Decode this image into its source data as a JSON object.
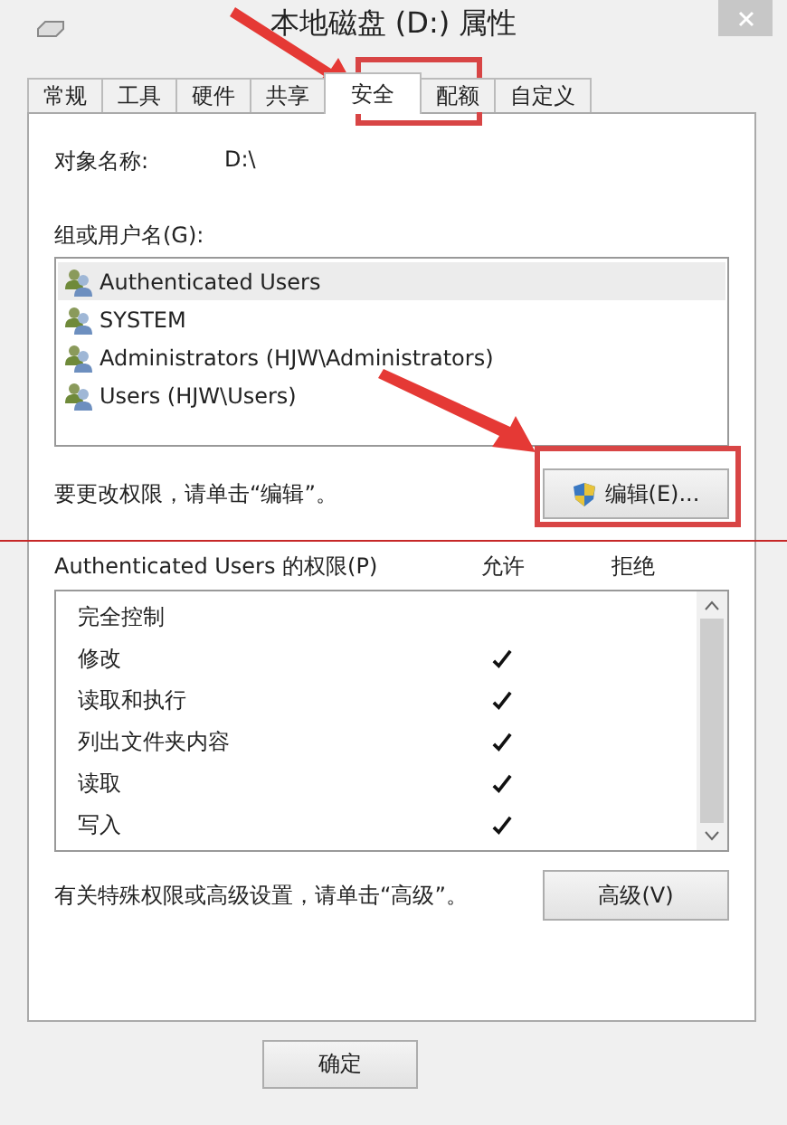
{
  "window": {
    "title": "本地磁盘 (D:) 属性"
  },
  "tabs": [
    {
      "label": "常规",
      "selected": false
    },
    {
      "label": "工具",
      "selected": false
    },
    {
      "label": "硬件",
      "selected": false
    },
    {
      "label": "共享",
      "selected": false
    },
    {
      "label": "安全",
      "selected": true
    },
    {
      "label": "配额",
      "selected": false
    },
    {
      "label": "自定义",
      "selected": false
    }
  ],
  "object_name": {
    "label": "对象名称:",
    "value": "D:\\"
  },
  "groups": {
    "label": "组或用户名(G):",
    "items": [
      {
        "name": "Authenticated Users",
        "selected": true
      },
      {
        "name": "SYSTEM",
        "selected": false
      },
      {
        "name": "Administrators (HJW\\Administrators)",
        "selected": false
      },
      {
        "name": "Users (HJW\\Users)",
        "selected": false
      }
    ]
  },
  "edit_hint": "要更改权限，请单击“编辑”。",
  "edit_button": "编辑(E)...",
  "permissions": {
    "header": "Authenticated Users 的权限(P)",
    "columns": [
      "允许",
      "拒绝"
    ],
    "rows": [
      {
        "name": "完全控制",
        "allow": false,
        "deny": false
      },
      {
        "name": "修改",
        "allow": true,
        "deny": false
      },
      {
        "name": "读取和执行",
        "allow": true,
        "deny": false
      },
      {
        "name": "列出文件夹内容",
        "allow": true,
        "deny": false
      },
      {
        "name": "读取",
        "allow": true,
        "deny": false
      },
      {
        "name": "写入",
        "allow": true,
        "deny": false
      }
    ]
  },
  "advanced_hint": "有关特殊权限或高级设置，请单击“高级”。",
  "advanced_button": "高级(V)",
  "buttons": [
    "确定"
  ]
}
